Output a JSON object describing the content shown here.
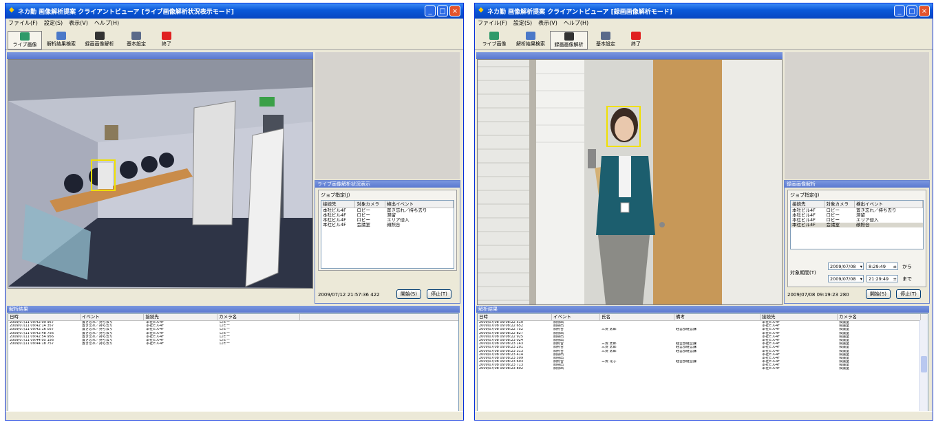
{
  "win1": {
    "title": "ネカ勤 画像解析提案 クライアントビューア [ライブ画像解析状況表示モード]",
    "menu": [
      "ファイル(F)",
      "設定(S)",
      "表示(V)",
      "ヘルプ(H)"
    ],
    "tools": [
      "ライブ画像",
      "解析結果検索",
      "録画画像解析",
      "基本設定",
      "終了"
    ],
    "panel_title": "ライブ画像解析状況表示",
    "job_label": "ジョブ指定(J)",
    "job_columns": [
      "接続先",
      "対象カメラ",
      "検出イベント"
    ],
    "jobs": [
      [
        "本社ビル4F",
        "ロビー",
        "置き忘れ／持ち去り"
      ],
      [
        "本社ビル4F",
        "ロビー",
        "滞留"
      ],
      [
        "本社ビル4F",
        "ロビー",
        "エリア侵入"
      ],
      [
        "本社ビル4F",
        "会議室",
        "顔照合"
      ]
    ],
    "timestamp": "2009/07/12 21:57:36 422",
    "start_button": "開始(S)",
    "stop_button": "停止(T)",
    "results_title": "解析結果",
    "results_columns": [
      "日時",
      "イベント",
      "接続先",
      "カメラ名"
    ],
    "results": [
      [
        "2009/07/11 09:42:09 957",
        "置き忘れ／持ち去り",
        "本社ビル4F",
        "ロビー"
      ],
      [
        "2009/07/11 09:42:14 357",
        "置き忘れ／持ち去り",
        "本社ビル4F",
        "ロビー"
      ],
      [
        "2009/07/11 09:42:16 057",
        "置き忘れ／持ち去り",
        "本社ビル4F",
        "ロビー"
      ],
      [
        "2009/07/11 09:42:48 756",
        "置き忘れ／持ち去り",
        "本社ビル4F",
        "ロビー"
      ],
      [
        "2009/07/11 09:42:54 956",
        "置き忘れ／持ち去り",
        "本社ビル4F",
        "ロビー"
      ],
      [
        "2009/07/11 09:44:05 156",
        "置き忘れ／持ち去り",
        "本社ビル4F",
        "ロビー"
      ],
      [
        "2009/07/11 09:44:18 757",
        "置き忘れ／持ち去り",
        "本社ビル4F",
        "ロビー"
      ]
    ]
  },
  "win2": {
    "title": "ネカ勤 画像解析提案 クライアントビューア [録画画像解析モード]",
    "menu": [
      "ファイル(F)",
      "設定(S)",
      "表示(V)",
      "ヘルプ(H)"
    ],
    "tools": [
      "ライブ画像",
      "解析結果検索",
      "録画画像解析",
      "基本設定",
      "終了"
    ],
    "panel_title": "録画画像解析",
    "job_label": "ジョブ指定(J)",
    "job_columns": [
      "接続先",
      "対象カメラ",
      "検出イベント"
    ],
    "jobs": [
      [
        "本社ビル4F",
        "ロビー",
        "置き忘れ／持ち去り"
      ],
      [
        "本社ビル4F",
        "ロビー",
        "滞留"
      ],
      [
        "本社ビル4F",
        "ロビー",
        "エリア侵入"
      ],
      [
        "本社ビル4F",
        "会議室",
        "顔照合"
      ]
    ],
    "period_label": "対象期間(T)",
    "from_date": "2009/07/08",
    "from_time": "8:29:49",
    "from_suffix": "から",
    "to_date": "2009/07/08",
    "to_time": "21:29:49",
    "to_suffix": "まで",
    "timestamp": "2009/07/08 09:19:23 280",
    "start_button": "開始(S)",
    "stop_button": "停止(T)",
    "results_title": "解析結果",
    "results_columns": [
      "日時",
      "イベント",
      "氏名",
      "備考",
      "接続先",
      "カメラ名"
    ],
    "results": [
      [
        "2009/07/08 09:08:22 510",
        "顔検出",
        "",
        "",
        "本社ビル4F",
        "会議室"
      ],
      [
        "2009/07/08 09:08:22 652",
        "顔検出",
        "",
        "",
        "本社ビル4F",
        "会議室"
      ],
      [
        "2009/07/08 09:08:22 752",
        "顔照合",
        "三菱 太郎",
        "経営部経営課",
        "本社ビル4F",
        "会議室"
      ],
      [
        "2009/07/08 09:08:22 827",
        "顔検出",
        "",
        "",
        "本社ビル4F",
        "会議室"
      ],
      [
        "2009/07/08 09:08:22 925",
        "顔検出",
        "",
        "",
        "本社ビル4F",
        "会議室"
      ],
      [
        "2009/07/08 09:08:23 024",
        "顔検出",
        "",
        "",
        "本社ビル4F",
        "会議室"
      ],
      [
        "2009/07/08 09:08:23 143",
        "顔照合",
        "三菱 太郎",
        "経営部経営課",
        "本社ビル4F",
        "会議室"
      ],
      [
        "2009/07/08 09:08:23 201",
        "顔照合",
        "三菱 太郎",
        "経営部経営課",
        "本社ビル4F",
        "会議室"
      ],
      [
        "2009/07/08 09:08:23 313",
        "顔照合",
        "三菱 太郎",
        "経営部経営課",
        "本社ビル4F",
        "会議室"
      ],
      [
        "2009/07/08 09:08:23 414",
        "顔検出",
        "",
        "",
        "本社ビル4F",
        "会議室"
      ],
      [
        "2009/07/08 09:08:23 509",
        "顔検出",
        "",
        "",
        "本社ビル4F",
        "会議室"
      ],
      [
        "2009/07/08 09:08:23 603",
        "顔照合",
        "三菱 花子",
        "経営部経営課",
        "本社ビル4F",
        "会議室"
      ],
      [
        "2009/07/08 09:08:23 713",
        "顔検出",
        "",
        "",
        "本社ビル4F",
        "会議室"
      ],
      [
        "2009/07/08 09:08:23 802",
        "顔検出",
        "",
        "",
        "本社ビル4F",
        "会議室"
      ]
    ]
  }
}
